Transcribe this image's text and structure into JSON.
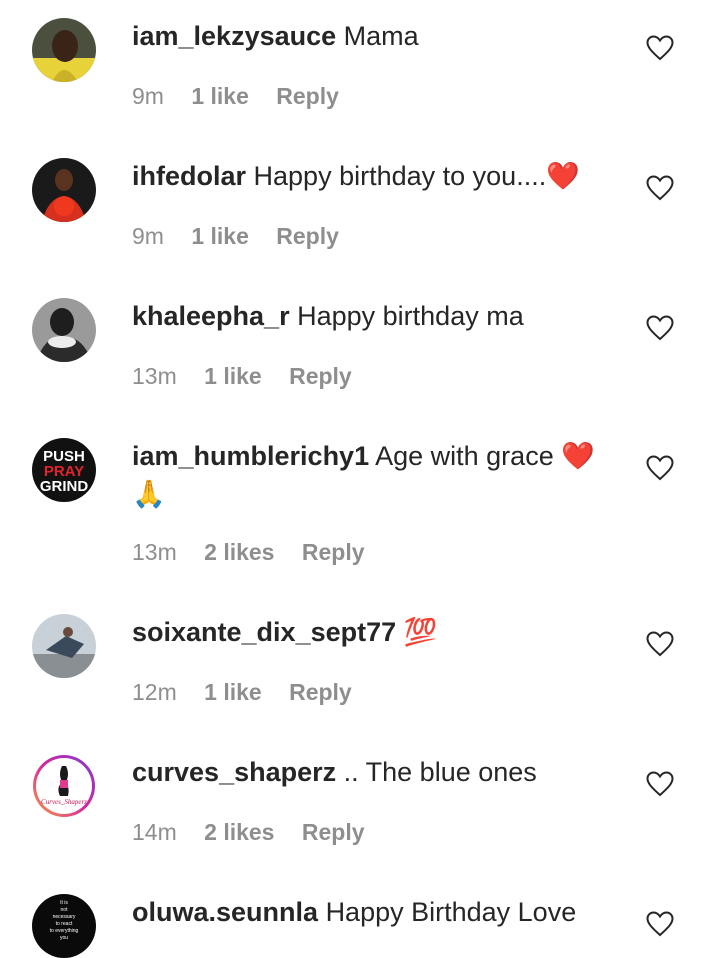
{
  "comments": [
    {
      "username": "iam_lekzysauce",
      "text": "Mama",
      "time": "9m",
      "likes": "1 like",
      "reply": "Reply"
    },
    {
      "username": "ihfedolar",
      "text": "Happy birthday to you....",
      "emoji": "❤️",
      "time": "9m",
      "likes": "1 like",
      "reply": "Reply"
    },
    {
      "username": "khaleepha_r",
      "text": "Happy birthday ma",
      "time": "13m",
      "likes": "1 like",
      "reply": "Reply"
    },
    {
      "username": "iam_humblerichy1",
      "text": "Age with grace",
      "emoji": "❤️",
      "emoji2": "🙏",
      "time": "13m",
      "likes": "2 likes",
      "reply": "Reply"
    },
    {
      "username": "soixante_dix_sept77",
      "text": "",
      "emoji": "💯",
      "time": "12m",
      "likes": "1 like",
      "reply": "Reply"
    },
    {
      "username": "curves_shaperz",
      "text": ".. The blue ones",
      "time": "14m",
      "likes": "2 likes",
      "reply": "Reply"
    },
    {
      "username": "oluwa.seunnla",
      "text": "Happy Birthday Love",
      "time": "",
      "likes": "",
      "reply": ""
    }
  ],
  "avatars": {
    "push_pray_grind": [
      "PUSH",
      "PRAY",
      "GRIND"
    ],
    "curves_logo": "Curves_Shaperz",
    "quote_text": [
      "It is",
      "not",
      "necessary",
      "to react",
      "to everything",
      "you"
    ]
  },
  "icons": {
    "like": "heart-outline-icon"
  },
  "colors": {
    "text": "#262626",
    "meta": "#8e8e8e",
    "heart_emoji": "#e0242e"
  }
}
